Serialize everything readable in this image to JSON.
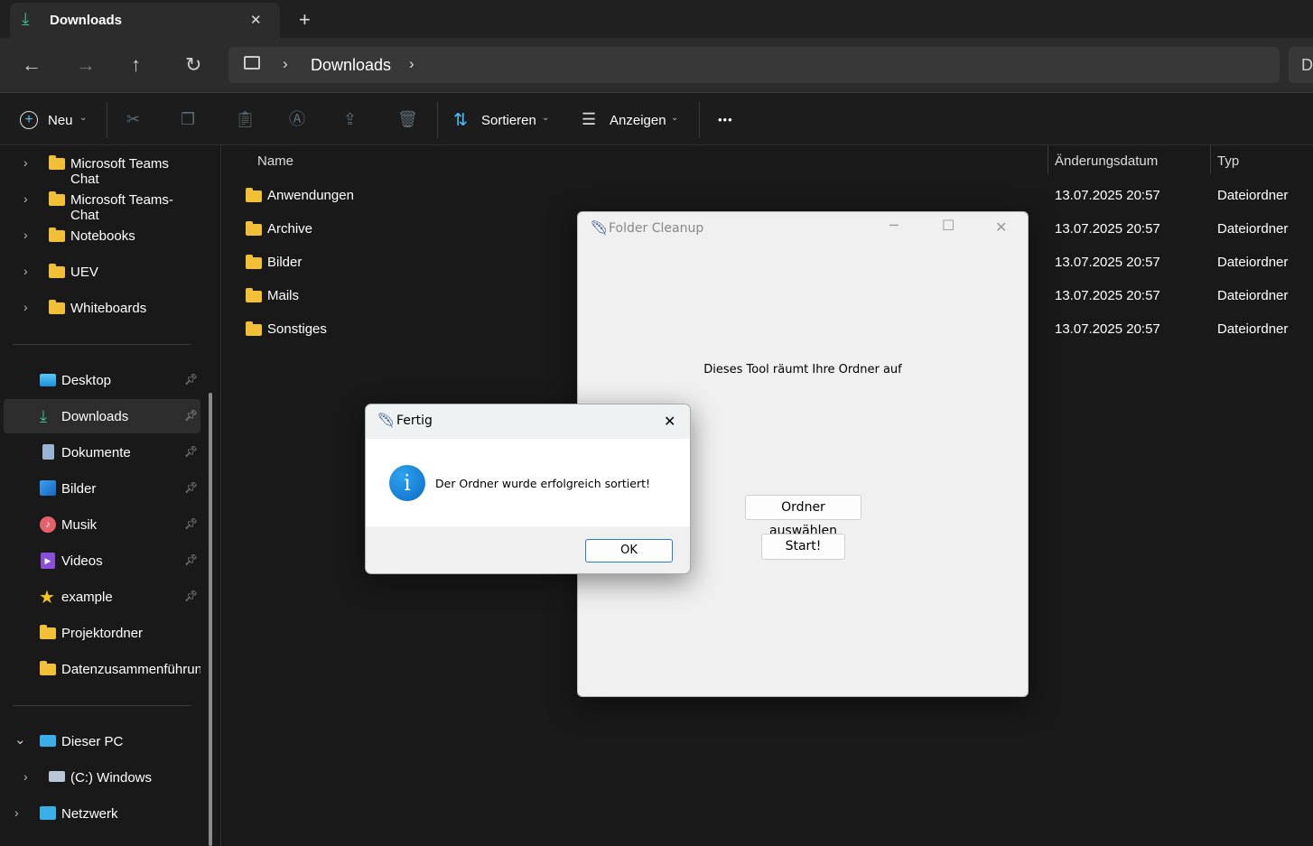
{
  "tab": {
    "title": "Downloads",
    "close": "✕",
    "new": "+"
  },
  "address": {
    "crumbs": [
      "Downloads"
    ],
    "search_hint": "D"
  },
  "toolbar": {
    "new_label": "Neu",
    "sort_label": "Sortieren",
    "view_label": "Anzeigen",
    "more": "•••"
  },
  "sidebar": {
    "tree": [
      "Microsoft Teams Chat",
      "Microsoft Teams-Chat",
      "Notebooks",
      "UEV",
      "Whiteboards"
    ],
    "pinned": [
      {
        "label": "Desktop",
        "icon": "desktop-icon",
        "pinned": true
      },
      {
        "label": "Downloads",
        "icon": "download-icon",
        "pinned": true,
        "selected": true
      },
      {
        "label": "Dokumente",
        "icon": "document-icon",
        "pinned": true
      },
      {
        "label": "Bilder",
        "icon": "pictures-icon",
        "pinned": true
      },
      {
        "label": "Musik",
        "icon": "music-icon",
        "pinned": true
      },
      {
        "label": "Videos",
        "icon": "videos-icon",
        "pinned": true
      },
      {
        "label": "example",
        "icon": "star-icon",
        "pinned": true
      },
      {
        "label": "Projektordner",
        "icon": "folder-icon"
      },
      {
        "label": "Datenzusammenführun",
        "icon": "folder-icon"
      }
    ],
    "this_pc": "Dieser PC",
    "drive": "(C:) Windows",
    "network": "Netzwerk"
  },
  "columns": {
    "name": "Name",
    "date": "Änderungsdatum",
    "type": "Typ"
  },
  "files": [
    {
      "name": "Anwendungen",
      "date": "13.07.2025 20:57",
      "type": "Dateiordner"
    },
    {
      "name": "Archive",
      "date": "13.07.2025 20:57",
      "type": "Dateiordner"
    },
    {
      "name": "Bilder",
      "date": "13.07.2025 20:57",
      "type": "Dateiordner"
    },
    {
      "name": "Mails",
      "date": "13.07.2025 20:57",
      "type": "Dateiordner"
    },
    {
      "name": "Sonstiges",
      "date": "13.07.2025 20:57",
      "type": "Dateiordner"
    }
  ],
  "cleanup": {
    "title": "Folder Cleanup",
    "label": "Dieses Tool räumt Ihre Ordner auf",
    "choose": "Ordner auswählen",
    "start": "Start!"
  },
  "dialog": {
    "title": "Fertig",
    "message": "Der Ordner wurde erfolgreich sortiert!",
    "ok": "OK",
    "close": "✕"
  },
  "colors": {
    "accent": "#4cc2ff",
    "folder": "#f2c037",
    "info": "#0a74d0"
  }
}
